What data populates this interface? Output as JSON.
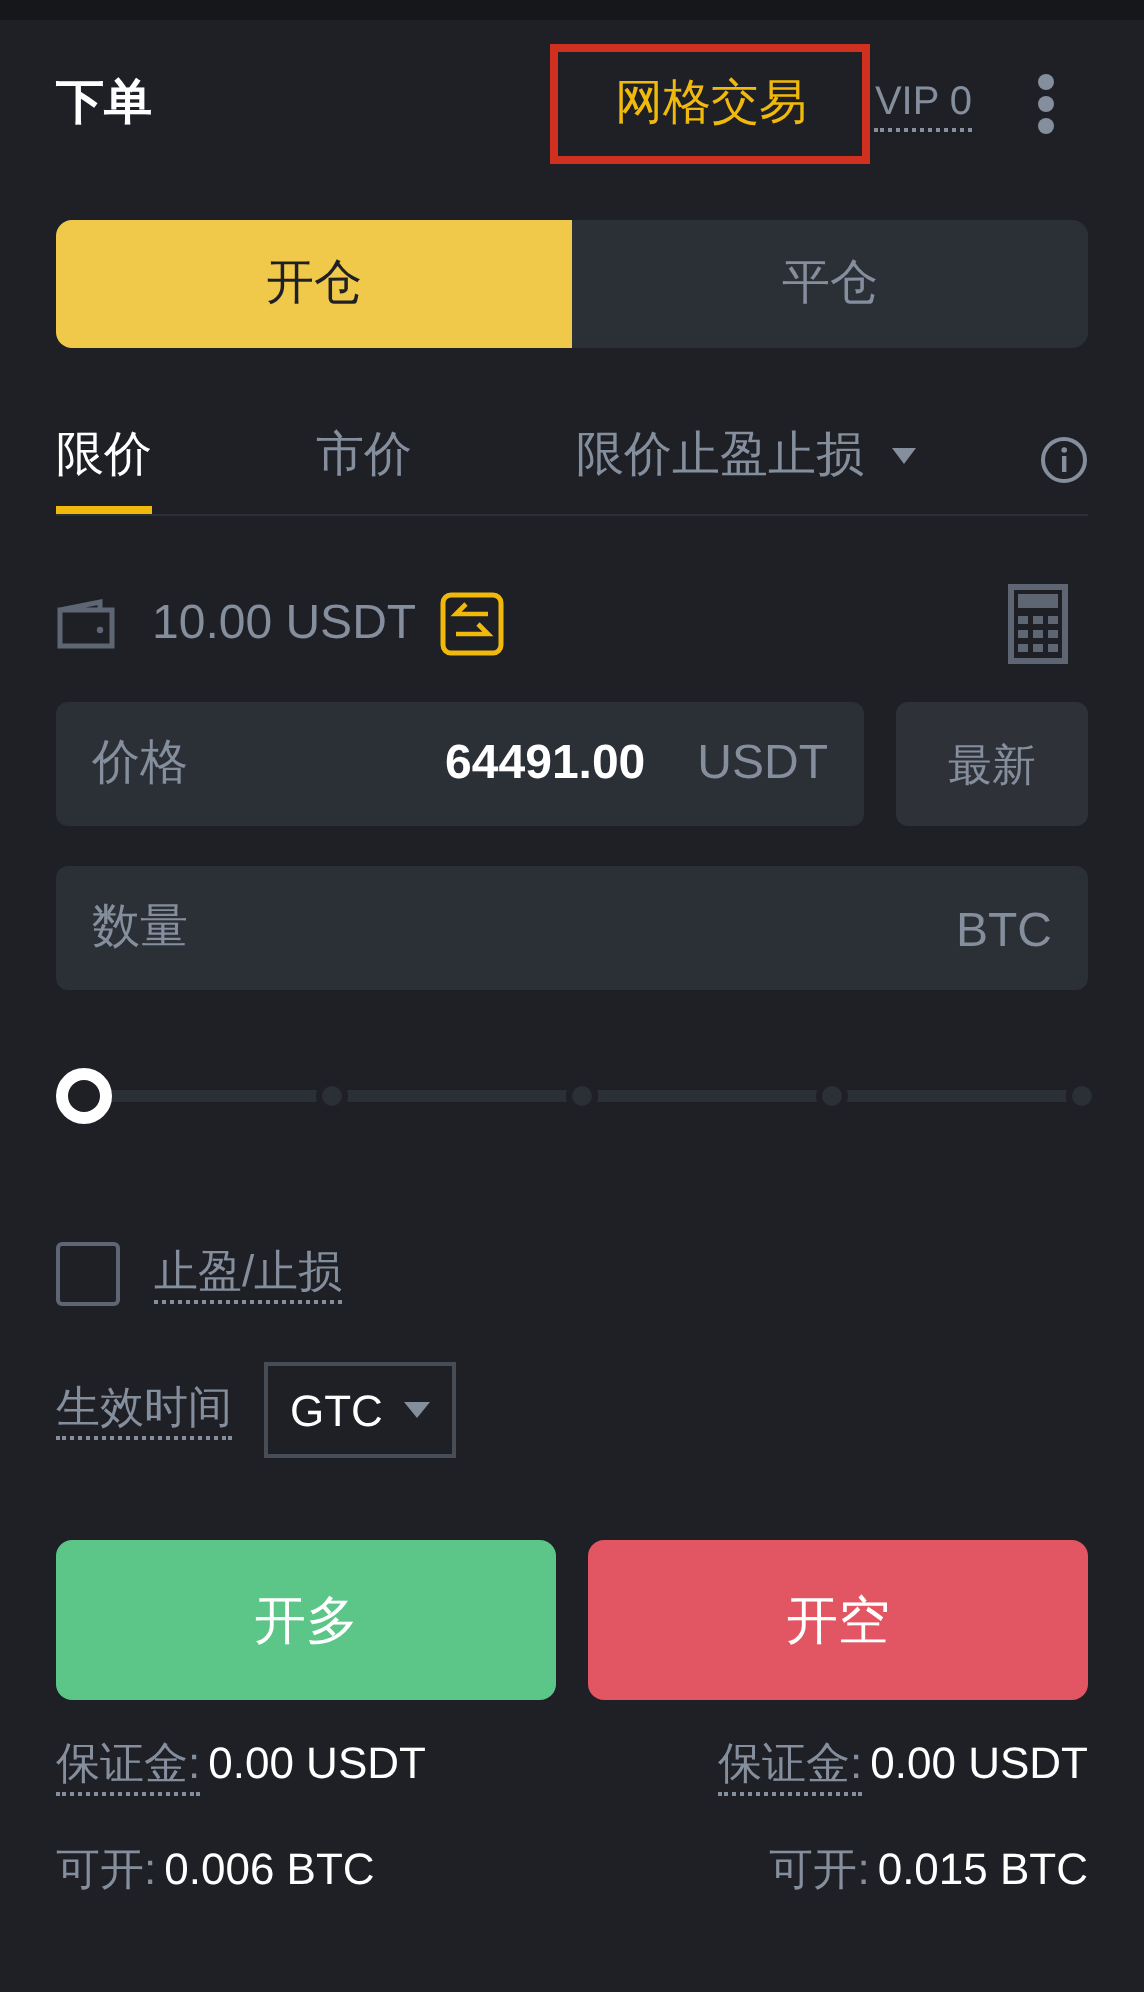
{
  "header": {
    "title": "下单",
    "grid_trading": {
      "label": "网格交易",
      "highlighted": true
    },
    "vip": "VIP 0"
  },
  "position_toggle": [
    {
      "label": "开仓",
      "selected": true
    },
    {
      "label": "平仓",
      "selected": false
    }
  ],
  "order_types": [
    {
      "label": "限价",
      "selected": true,
      "dropdown": false
    },
    {
      "label": "市价",
      "selected": false,
      "dropdown": false
    },
    {
      "label": "限价止盈止损",
      "selected": false,
      "dropdown": true
    }
  ],
  "balance": "10.00 USDT",
  "price_field": {
    "label": "价格",
    "value": "64491.00",
    "unit": "USDT",
    "latest_button": "最新"
  },
  "quantity_field": {
    "placeholder": "数量",
    "unit": "BTC"
  },
  "slider": {
    "level": 0
  },
  "tp_sl": {
    "label": "止盈/止损",
    "checked": false
  },
  "time_in_force": {
    "label": "生效时间",
    "value": "GTC"
  },
  "actions": [
    {
      "kind": "long",
      "label": "开多",
      "margin_label": "保证金:",
      "margin": "0.00 USDT",
      "available_label": "可开:",
      "available": "0.006 BTC"
    },
    {
      "kind": "short",
      "label": "开空",
      "margin_label": "保证金:",
      "margin": "0.00 USDT",
      "available_label": "可开:",
      "available": "0.015 BTC"
    }
  ]
}
